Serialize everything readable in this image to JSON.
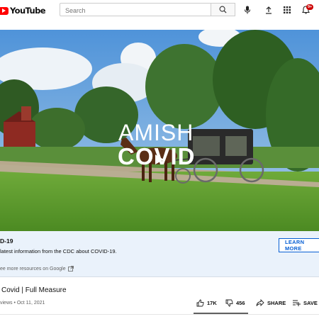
{
  "header": {
    "logo_text": "YouTube",
    "search_placeholder": "Search",
    "notification_count": "9+"
  },
  "video": {
    "title_line1": "AMISH",
    "title_line2": "COVID"
  },
  "info_panel": {
    "title": "D-19",
    "text": "latest information from the CDC about COVID-19.",
    "learn_more": "LEARN MORE",
    "resources": "ee more resources on Google"
  },
  "video_info": {
    "title": "Covid | Full Measure",
    "meta": "views • Oct 11, 2021",
    "likes": "17K",
    "dislikes": "456",
    "share": "SHARE",
    "save": "SAVE"
  },
  "colors": {
    "brand_red": "#ff0000",
    "link_blue": "#065fd4",
    "info_bg": "#eaf2fb"
  },
  "icons": [
    "youtube-logo-icon",
    "search-icon",
    "mic-icon",
    "upload-icon",
    "apps-icon",
    "bell-icon",
    "play-icon",
    "external-link-icon",
    "thumbs-up-icon",
    "thumbs-down-icon",
    "share-icon",
    "save-icon"
  ]
}
